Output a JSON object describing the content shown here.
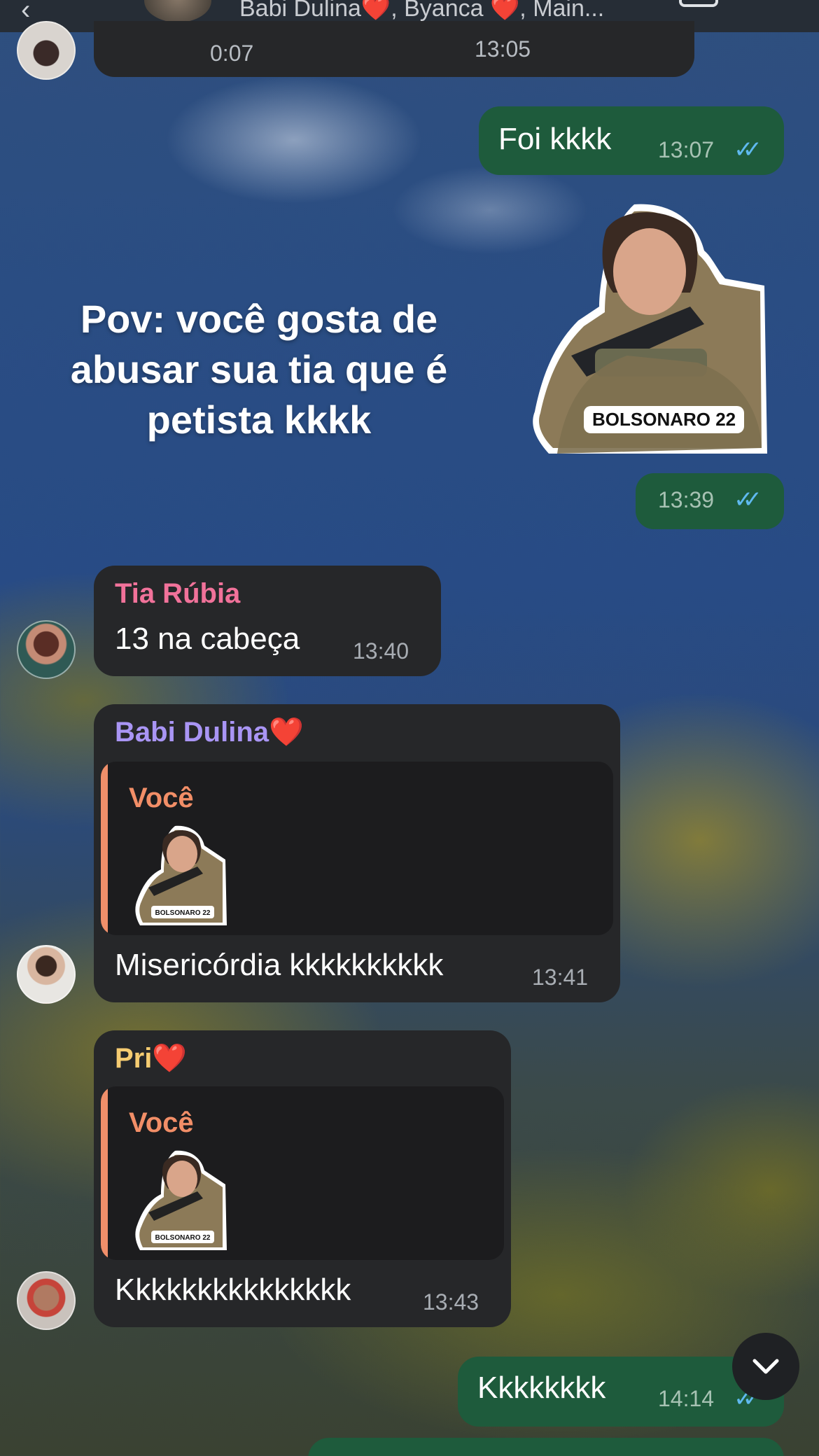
{
  "header": {
    "title": "Babi Dulina❤️, Byanca ❤️, Main...",
    "back_icon": "chevron-left-icon",
    "video_icon": "video-call-icon"
  },
  "top_message": {
    "duration": "0:07",
    "time": "13:05"
  },
  "background_caption": "Pov: você gosta de abusar sua tia que é petista kkkk",
  "messages": [
    {
      "direction": "out",
      "text": "Foi kkkk",
      "time": "13:07",
      "status": "read"
    },
    {
      "direction": "out",
      "type": "sticker",
      "sticker_label": "BOLSONARO 22",
      "time": "13:39",
      "status": "read"
    },
    {
      "direction": "in",
      "sender": "Tia Rúbia",
      "sender_color": "#f1729a",
      "text": "13 na cabeça",
      "time": "13:40"
    },
    {
      "direction": "in",
      "sender": "Babi Dulina❤️",
      "sender_color": "#a995f4",
      "reply_to": "Você",
      "reply_sticker_label": "BOLSONARO 22",
      "text": "Misericórdia kkkkkkkkkk",
      "time": "13:41"
    },
    {
      "direction": "in",
      "sender": "Pri❤️",
      "sender_color": "#f6cc71",
      "reply_to": "Você",
      "reply_sticker_label": "BOLSONARO 22",
      "text": "Kkkkkkkkkkkkkkk",
      "time": "13:43"
    },
    {
      "direction": "out",
      "text": "Kkkkkkkk",
      "time": "14:14",
      "status": "read"
    }
  ],
  "colors": {
    "outgoing_bubble": "#1e5b3c",
    "incoming_bubble": "#262729",
    "read_ticks": "#5fb9ef",
    "reply_accent": "#f08f6a"
  },
  "scroll_button_icon": "chevron-down-icon"
}
